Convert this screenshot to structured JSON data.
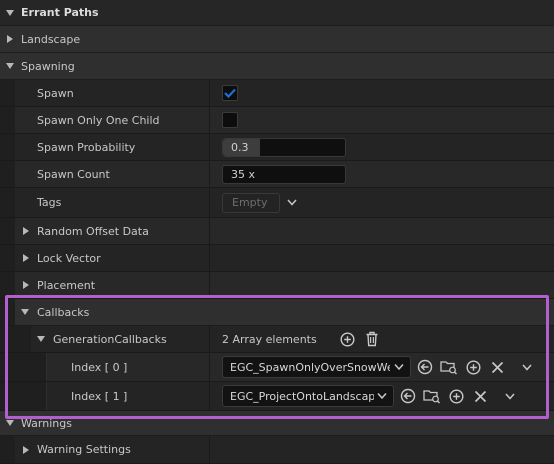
{
  "section_title": "Errant Paths",
  "landscape": "Landscape",
  "spawning": {
    "label": "Spawning",
    "spawn_label": "Spawn",
    "spawn_checked": true,
    "spawn_one_child_label": "Spawn Only One Child",
    "spawn_one_child_checked": false,
    "probability_label": "Spawn Probability",
    "probability_value": "0.3",
    "probability_fraction": 0.3,
    "count_label": "Spawn Count",
    "count_value": "35 x",
    "tags_label": "Tags",
    "tags_value": "Empty",
    "random_offset_label": "Random Offset Data",
    "lock_vector_label": "Lock Vector",
    "placement_label": "Placement"
  },
  "callbacks": {
    "label": "Callbacks",
    "generation_label": "GenerationCallbacks",
    "array_count": "2 Array elements",
    "items": [
      {
        "index": "Index [ 0 ]",
        "asset": "EGC_SpawnOnlyOverSnowWeig"
      },
      {
        "index": "Index [ 1 ]",
        "asset": "EGC_ProjectOntoLandscape"
      }
    ]
  },
  "warnings": {
    "label": "Warnings",
    "settings_label": "Warning Settings"
  },
  "colors": {
    "accent": "#1f6fd6",
    "highlight": "#b45fd0"
  }
}
